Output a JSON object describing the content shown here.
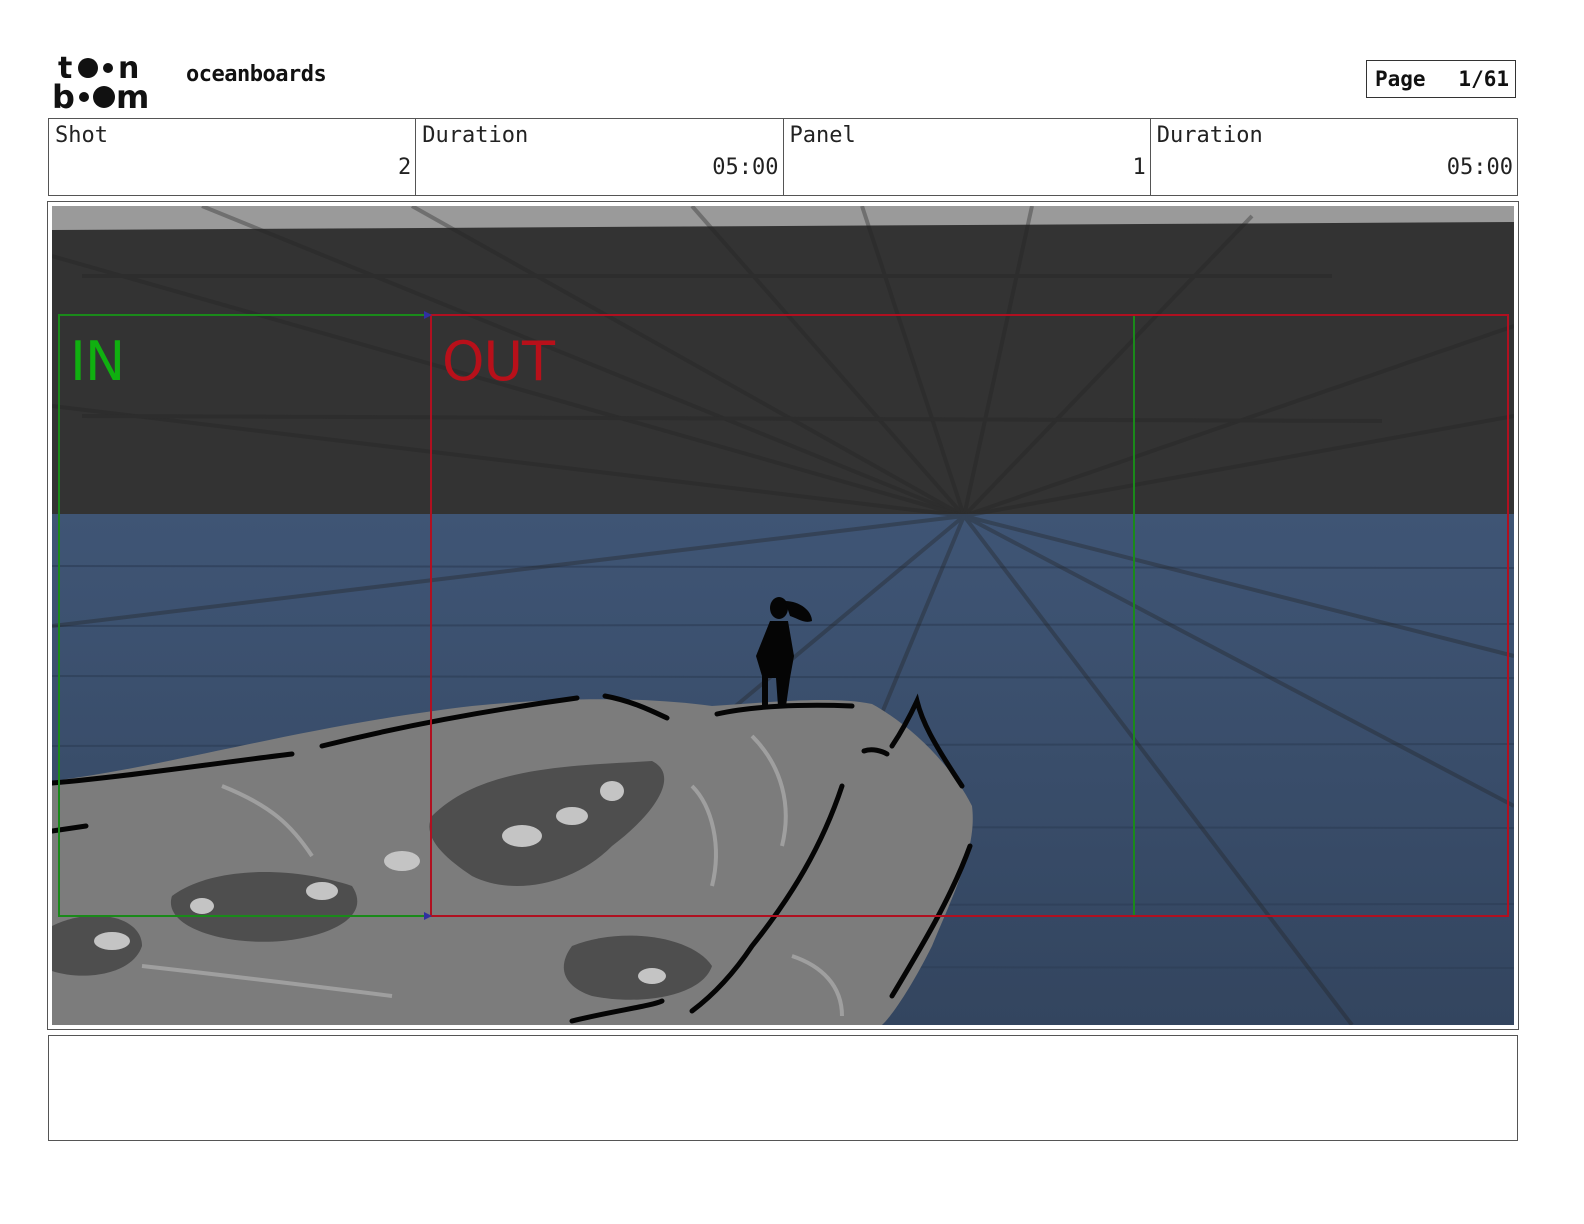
{
  "header": {
    "logo_text_top": "toon",
    "logo_text_bottom": "boom",
    "project_title": "oceanboards",
    "page_label": "Page",
    "page_number": "1/61"
  },
  "info": {
    "cells": [
      {
        "label": "Shot",
        "value": "2"
      },
      {
        "label": "Duration",
        "value": "05:00"
      },
      {
        "label": "Panel",
        "value": "1"
      },
      {
        "label": "Duration",
        "value": "05:00"
      }
    ]
  },
  "panel": {
    "in_label": "IN",
    "out_label": "OUT",
    "colors": {
      "sky": "#333333",
      "sea": "#3a4e6a",
      "rock": "#7a7a7a",
      "in_frame": "#1a8a1a",
      "out_frame": "#b01020"
    }
  },
  "notes": {
    "text": ""
  }
}
